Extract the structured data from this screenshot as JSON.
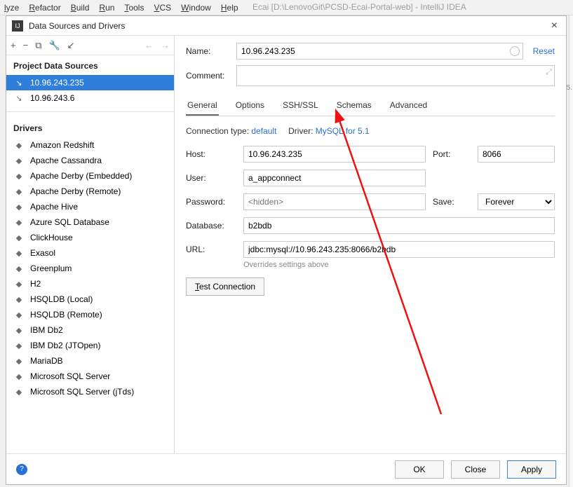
{
  "menubar": [
    "lyze",
    "Refactor",
    "Build",
    "Run",
    "Tools",
    "VCS",
    "Window",
    "Help"
  ],
  "titlebar": "Ecai [D:\\LenovoGit\\PCSD-Ecai-Portal-web] - IntelliJ IDEA",
  "dialog_title": "Data Sources and Drivers",
  "reset": "Reset",
  "sections": {
    "project": "Project Data Sources",
    "drivers": "Drivers"
  },
  "datasources": [
    {
      "label": "10.96.243.235",
      "selected": true
    },
    {
      "label": "10.96.243.6",
      "selected": false
    }
  ],
  "drivers": [
    "Amazon Redshift",
    "Apache Cassandra",
    "Apache Derby (Embedded)",
    "Apache Derby (Remote)",
    "Apache Hive",
    "Azure SQL Database",
    "ClickHouse",
    "Exasol",
    "Greenplum",
    "H2",
    "HSQLDB (Local)",
    "HSQLDB (Remote)",
    "IBM Db2",
    "IBM Db2 (JTOpen)",
    "MariaDB",
    "Microsoft SQL Server",
    "Microsoft SQL Server (jTds)"
  ],
  "form": {
    "name_label": "Name:",
    "name_value": "10.96.243.235",
    "comment_label": "Comment:"
  },
  "tabs": [
    "General",
    "Options",
    "SSH/SSL",
    "Schemas",
    "Advanced"
  ],
  "conn": {
    "type_label": "Connection type:",
    "type_value": "default",
    "driver_label": "Driver:",
    "driver_value": "MySQL for 5.1"
  },
  "fields": {
    "host_label": "Host:",
    "host": "10.96.243.235",
    "port_label": "Port:",
    "port": "8066",
    "user_label": "User:",
    "user": "a_appconnect",
    "password_label": "Password:",
    "password_ph": "<hidden>",
    "save_label": "Save:",
    "save_value": "Forever",
    "database_label": "Database:",
    "database": "b2bdb",
    "url_label": "URL:",
    "url": "jdbc:mysql://10.96.243.235:8066/b2bdb",
    "url_hint": "Overrides settings above",
    "test_label": "Test Connection"
  },
  "footer": {
    "ok": "OK",
    "close": "Close",
    "apply": "Apply"
  },
  "side_num": "5."
}
